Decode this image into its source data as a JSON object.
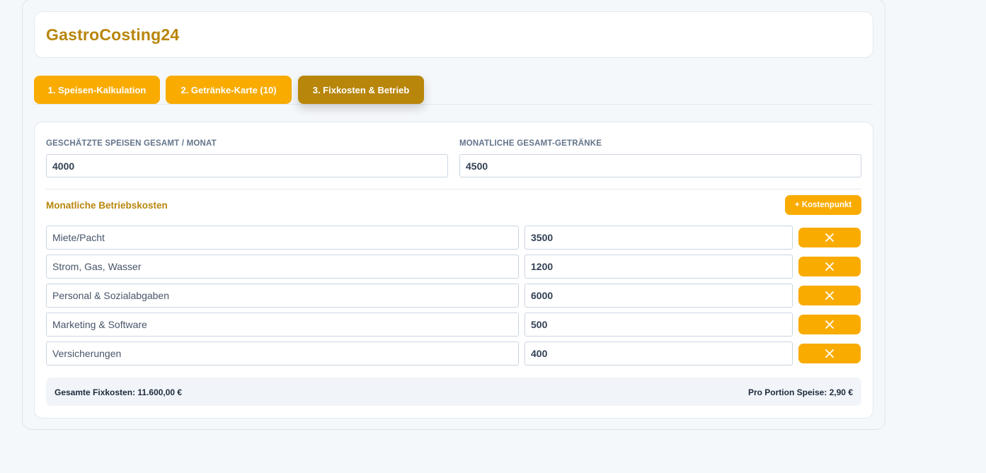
{
  "app": {
    "title": "GastroCosting24"
  },
  "tabs": [
    {
      "label": "1. Speisen-Kalkulation"
    },
    {
      "label": "2. Getränke-Karte (10)"
    },
    {
      "label": "3. Fixkosten & Betrieb"
    }
  ],
  "fields": {
    "dishes": {
      "label": "GESCHÄTZTE SPEISEN GESAMT / MONAT",
      "value": "4000"
    },
    "drinks": {
      "label": "MONATLICHE GESAMT-GETRÄNKE",
      "value": "4500"
    }
  },
  "costs": {
    "title": "Monatliche Betriebskosten",
    "add_label": "+ Kostenpunkt",
    "items": [
      {
        "name": "Miete/Pacht",
        "value": "3500"
      },
      {
        "name": "Strom, Gas, Wasser",
        "value": "1200"
      },
      {
        "name": "Personal & Sozialabgaben",
        "value": "6000"
      },
      {
        "name": "Marketing & Software",
        "value": "500"
      },
      {
        "name": "Versicherungen",
        "value": "400"
      }
    ]
  },
  "summary": {
    "total": "Gesamte Fixkosten: 11.600,00 €",
    "per_portion": "Pro Portion Speise: 2,90 €"
  },
  "icons": {
    "delete": "close-icon"
  },
  "colors": {
    "accent": "#f9ab00",
    "accent_dark": "#b8860b"
  }
}
